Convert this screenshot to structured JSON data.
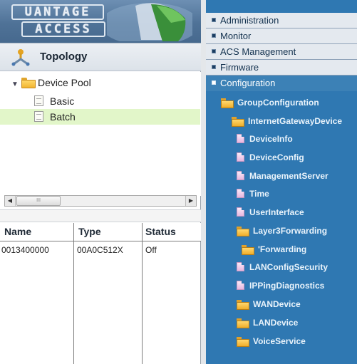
{
  "logo": {
    "line1": "UANTAGE",
    "line2": "ACCESS"
  },
  "topology": {
    "title": "Topology"
  },
  "tree": {
    "root": "Device Pool",
    "children": [
      "Basic",
      "Batch"
    ],
    "selected": "Batch"
  },
  "table": {
    "headers": [
      "Name",
      "Type",
      "Status"
    ],
    "rows": [
      {
        "name": "0013400000",
        "type": "00A0C512X",
        "status": "Off"
      }
    ]
  },
  "menu": {
    "items": [
      "Administration",
      "Monitor",
      "ACS  Management",
      "Firmware",
      "Configuration"
    ],
    "active": "Configuration"
  },
  "config_tree": [
    {
      "label": "GroupConfiguration",
      "icon": "folder-open-icon"
    },
    {
      "label": "InternetGatewayDevice",
      "icon": "folder-open-icon"
    },
    {
      "label": "DeviceInfo",
      "icon": "file-icon"
    },
    {
      "label": "DeviceConfig",
      "icon": "file-icon"
    },
    {
      "label": "ManagementServer",
      "icon": "file-icon"
    },
    {
      "label": "Time",
      "icon": "file-icon"
    },
    {
      "label": "UserInterface",
      "icon": "file-icon"
    },
    {
      "label": "Layer3Forwarding",
      "icon": "folder-open-icon"
    },
    {
      "label": "'Forwarding",
      "icon": "folder-icon"
    },
    {
      "label": "LANConfigSecurity",
      "icon": "file-icon"
    },
    {
      "label": "IPPingDiagnostics",
      "icon": "file-icon"
    },
    {
      "label": "WANDevice",
      "icon": "folder-icon"
    },
    {
      "label": "LANDevice",
      "icon": "folder-icon"
    },
    {
      "label": "VoiceService",
      "icon": "folder-icon"
    }
  ],
  "colors": {
    "accent": "#2f78b2",
    "selection": "#e2f6c9"
  }
}
